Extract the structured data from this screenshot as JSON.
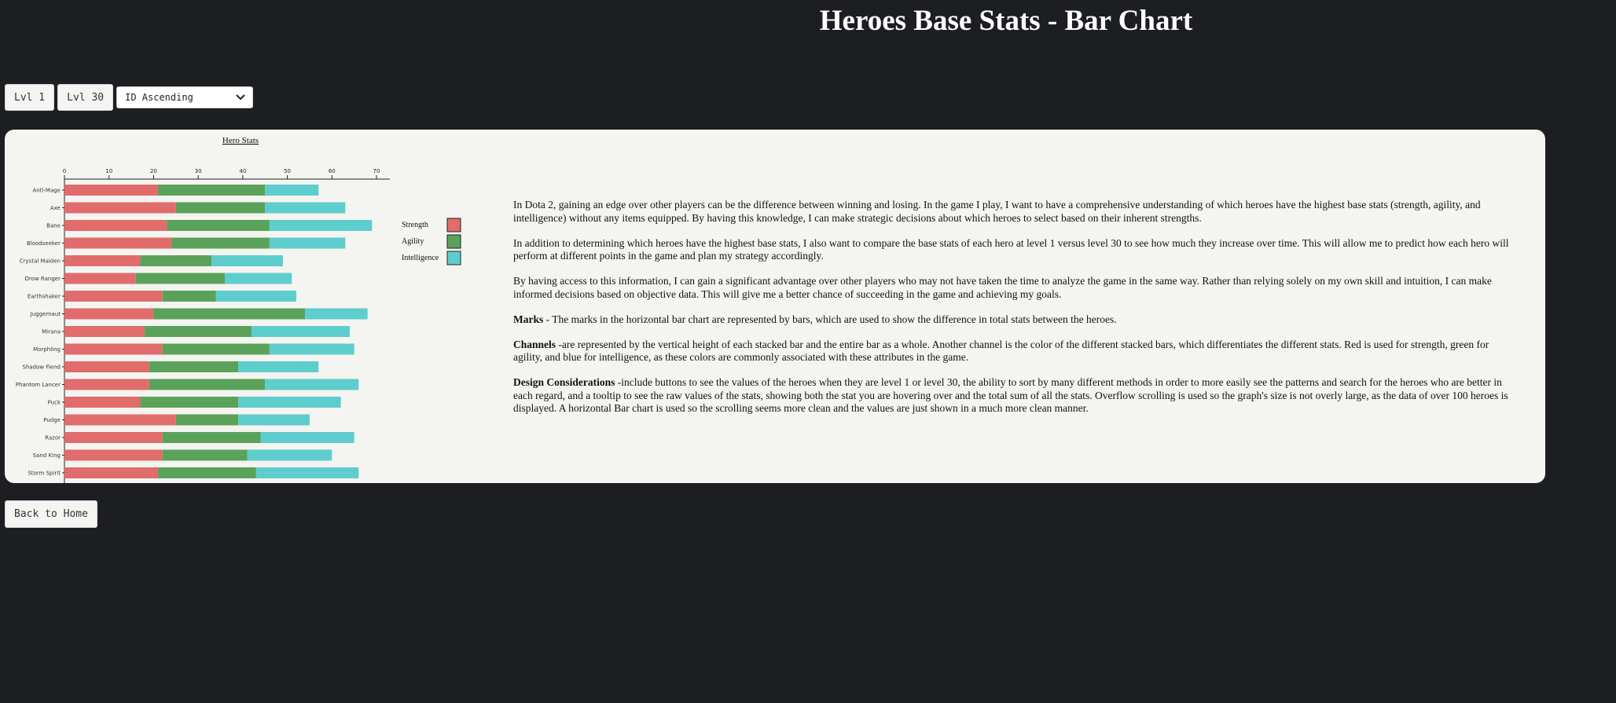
{
  "page": {
    "title": "Heroes Base Stats - Bar Chart"
  },
  "controls": {
    "lvl1_label": "Lvl 1",
    "lvl30_label": "Lvl 30",
    "sort_value": "ID Ascending"
  },
  "chart_data": {
    "type": "bar",
    "orientation": "horizontal",
    "stacked": true,
    "title": "Hero Stats",
    "xlim": [
      0,
      73
    ],
    "x_ticks": [
      0,
      10,
      20,
      30,
      40,
      50,
      60,
      70
    ],
    "legend_position": "right",
    "categories": [
      "Anti-Mage",
      "Axe",
      "Bane",
      "Bloodseeker",
      "Crystal Maiden",
      "Drow Ranger",
      "Earthshaker",
      "Juggernaut",
      "Mirana",
      "Morphling",
      "Shadow Fiend",
      "Phantom Lancer",
      "Puck",
      "Pudge",
      "Razor",
      "Sand King",
      "Storm Spirit"
    ],
    "series": [
      {
        "name": "Strength",
        "color": "#e06c6c",
        "values": [
          21,
          25,
          23,
          24,
          17,
          16,
          22,
          20,
          18,
          22,
          19,
          19,
          17,
          25,
          22,
          22,
          21
        ]
      },
      {
        "name": "Agility",
        "color": "#5aa25a",
        "values": [
          24,
          20,
          23,
          22,
          16,
          20,
          12,
          34,
          24,
          24,
          20,
          26,
          22,
          14,
          22,
          19,
          22
        ]
      },
      {
        "name": "Intelligence",
        "color": "#5ecdcd",
        "values": [
          12,
          18,
          23,
          17,
          16,
          15,
          18,
          14,
          22,
          19,
          18,
          21,
          23,
          16,
          21,
          19,
          23
        ]
      }
    ]
  },
  "description": {
    "p1": "In Dota 2, gaining an edge over other players can be the difference between winning and losing. In the game I play, I want to have a comprehensive understanding of which heroes have the highest base stats (strength, agility, and intelligence) without any items equipped. By having this knowledge, I can make strategic decisions about which heroes to select based on their inherent strengths.",
    "p2": "In addition to determining which heroes have the highest base stats, I also want to compare the base stats of each hero at level 1 versus level 30 to see how much they increase over time. This will allow me to predict how each hero will perform at different points in the game and plan my strategy accordingly.",
    "p3": "By having access to this information, I can gain a significant advantage over other players who may not have taken the time to analyze the game in the same way. Rather than relying solely on my own skill and intuition, I can make informed decisions based on objective data. This will give me a better chance of succeeding in the game and achieving my goals.",
    "marks_label": "Marks",
    "marks_text": " - The marks in the horizontal bar chart are represented by bars, which are used to show the difference in total stats between the heroes.",
    "channels_label": "Channels",
    "channels_text": " -are represented by the vertical height of each stacked bar and the entire bar as a whole. Another channel is the color of the different stacked bars, which differentiates the different stats. Red is used for strength, green for agility, and blue for intelligence, as these colors are commonly associated with these attributes in the game.",
    "design_label": "Design Considerations",
    "design_text": " -include buttons to see the values of the heroes when they are level 1 or level 30, the ability to sort by many different methods in order to more easily see the patterns and search for the heroes who are better in each regard, and a tooltip to see the raw values of the stats, showing both the stat you are hovering over and the total sum of all the stats. Overflow scrolling is used so the graph's size is not overly large, as the data of over 100 heroes is displayed. A horizontal Bar chart is used so the scrolling seems more clean and the values are just shown in a much more clean manner."
  },
  "footer": {
    "back_label": "Back to Home"
  }
}
